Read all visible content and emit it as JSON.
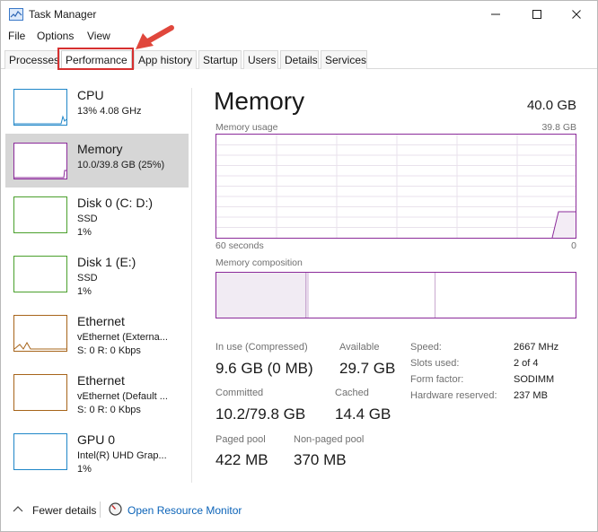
{
  "window": {
    "title": "Task Manager",
    "icon": "task-manager-icon",
    "controls": [
      "minimize-icon",
      "maximize-icon",
      "close-icon"
    ]
  },
  "menu": [
    "File",
    "Options",
    "View"
  ],
  "tabs": [
    {
      "label": "Processes",
      "active": false
    },
    {
      "label": "Performance",
      "active": true
    },
    {
      "label": "App history",
      "active": false
    },
    {
      "label": "Startup",
      "active": false
    },
    {
      "label": "Users",
      "active": false
    },
    {
      "label": "Details",
      "active": false
    },
    {
      "label": "Services",
      "active": false
    }
  ],
  "annotation": {
    "highlight_color": "#d63030",
    "target": "Performance"
  },
  "sidebar": {
    "items": [
      {
        "name": "CPU",
        "lines": [
          "13%  4.08 GHz"
        ],
        "color": "#1f86c8",
        "selected": false
      },
      {
        "name": "Memory",
        "lines": [
          "10.0/39.8 GB (25%)"
        ],
        "color": "#8b2b9a",
        "selected": true
      },
      {
        "name": "Disk 0 (C: D:)",
        "lines": [
          "SSD",
          "1%"
        ],
        "color": "#4aa02c",
        "selected": false
      },
      {
        "name": "Disk 1 (E:)",
        "lines": [
          "SSD",
          "1%"
        ],
        "color": "#4aa02c",
        "selected": false
      },
      {
        "name": "Ethernet",
        "lines": [
          "vEthernet (Externa...",
          "S: 0  R: 0 Kbps"
        ],
        "color": "#a7641a",
        "selected": false
      },
      {
        "name": "Ethernet",
        "lines": [
          "vEthernet (Default ...",
          "S: 0  R: 0 Kbps"
        ],
        "color": "#a7641a",
        "selected": false
      },
      {
        "name": "GPU 0",
        "lines": [
          "Intel(R) UHD Grap...",
          "1%"
        ],
        "color": "#1f86c8",
        "selected": false
      }
    ]
  },
  "main": {
    "title": "Memory",
    "capacity": "40.0 GB",
    "usage_label": "Memory usage",
    "usage_max": "39.8 GB",
    "time_left": "60 seconds",
    "time_right": "0",
    "composition_label": "Memory composition",
    "accent": "#8b2b9a",
    "stats": {
      "in_use_label": "In use (Compressed)",
      "in_use_value": "9.6 GB (0 MB)",
      "available_label": "Available",
      "available_value": "29.7 GB",
      "committed_label": "Committed",
      "committed_value": "10.2/79.8 GB",
      "cached_label": "Cached",
      "cached_value": "14.4 GB",
      "paged_label": "Paged pool",
      "paged_value": "422 MB",
      "nonpaged_label": "Non-paged pool",
      "nonpaged_value": "370 MB"
    },
    "details": [
      {
        "key": "Speed:",
        "value": "2667 MHz"
      },
      {
        "key": "Slots used:",
        "value": "2 of 4"
      },
      {
        "key": "Form factor:",
        "value": "SODIMM"
      },
      {
        "key": "Hardware reserved:",
        "value": "237 MB"
      }
    ]
  },
  "footer": {
    "fewer_details": "Fewer details",
    "open_resmon": "Open Resource Monitor"
  }
}
